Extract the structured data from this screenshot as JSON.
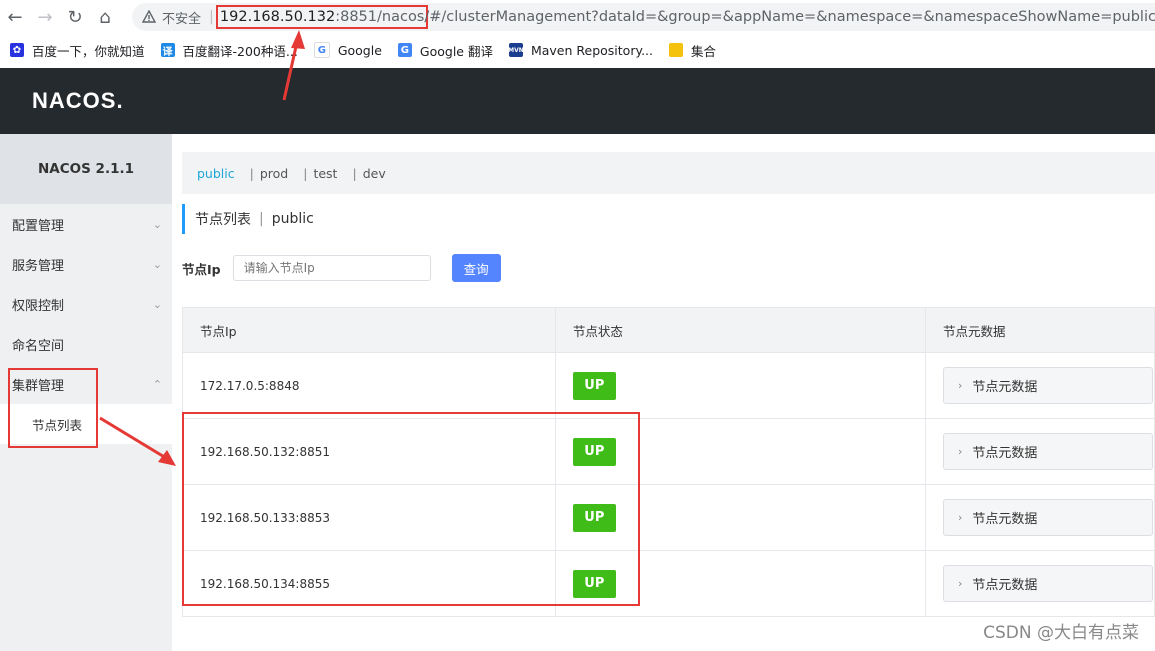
{
  "browser": {
    "insecure_label": "不安全",
    "url_host": "192.168.50.132",
    "url_port_path": ":8851/nacos",
    "url_rest": "/#/clusterManagement?dataId=&group=&appName=&namespace=&namespaceShowName=public"
  },
  "bookmarks": [
    {
      "label": "百度一下，你就知道",
      "icon": "baidu-icon",
      "color": "#2932e1"
    },
    {
      "label": "百度翻译-200种语...",
      "icon": "translate-icon",
      "color": "#1e88e5"
    },
    {
      "label": "Google",
      "icon": "google-icon",
      "color": "#4285f4"
    },
    {
      "label": "Google 翻译",
      "icon": "google-translate-icon",
      "color": "#4285f4"
    },
    {
      "label": "Maven Repository...",
      "icon": "maven-icon",
      "color": "#1a3d8f"
    },
    {
      "label": "集合",
      "icon": "folder-icon",
      "color": "#f4c20d"
    }
  ],
  "app": {
    "logo": "NACOS.",
    "version": "NACOS 2.1.1"
  },
  "sidebar": {
    "items": [
      {
        "label": "配置管理"
      },
      {
        "label": "服务管理"
      },
      {
        "label": "权限控制"
      },
      {
        "label": "命名空间"
      },
      {
        "label": "集群管理"
      }
    ],
    "sub_item": "节点列表"
  },
  "namespaces": {
    "tabs": [
      "public",
      "prod",
      "test",
      "dev"
    ],
    "separator": "|"
  },
  "page": {
    "title": "节点列表",
    "title_separator": "|",
    "namespace": "public"
  },
  "search": {
    "label": "节点Ip",
    "placeholder": "请输入节点Ip",
    "button": "查询"
  },
  "table": {
    "headers": [
      "节点Ip",
      "节点状态",
      "节点元数据"
    ],
    "rows": [
      {
        "ip": "172.17.0.5:8848",
        "status": "UP",
        "meta": "节点元数据"
      },
      {
        "ip": "192.168.50.132:8851",
        "status": "UP",
        "meta": "节点元数据"
      },
      {
        "ip": "192.168.50.133:8853",
        "status": "UP",
        "meta": "节点元数据"
      },
      {
        "ip": "192.168.50.134:8855",
        "status": "UP",
        "meta": "节点元数据"
      }
    ]
  },
  "watermark": "CSDN @大白有点菜",
  "colors": {
    "accent": "#1fa6d8",
    "up_green": "#3fbc18",
    "primary_button": "#5584ff",
    "annotation_red": "#e53935"
  }
}
